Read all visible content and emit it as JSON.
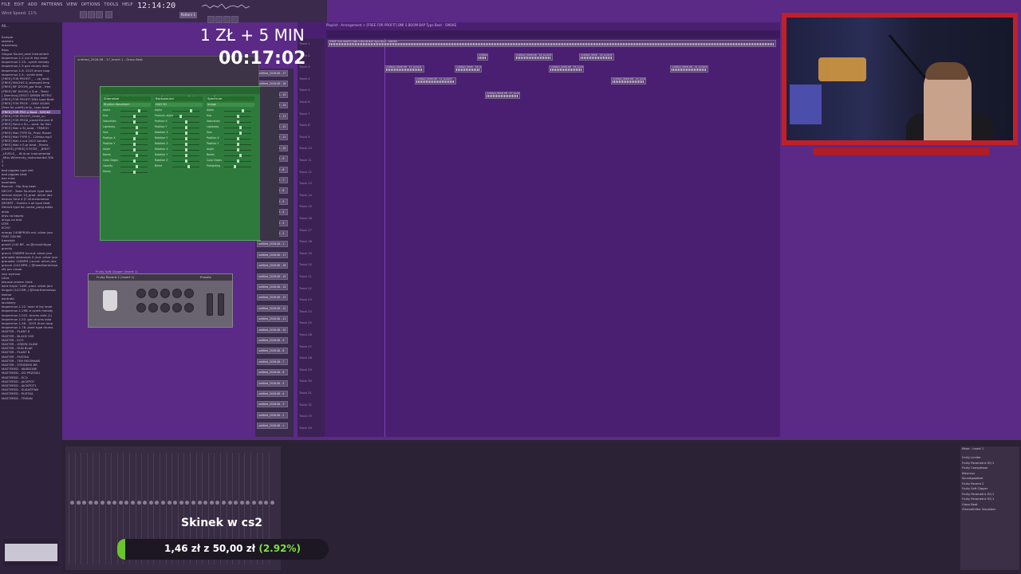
{
  "menu": {
    "items": [
      "FILE",
      "EDIT",
      "ADD",
      "PATTERNS",
      "VIEW",
      "OPTIONS",
      "TOOLS",
      "HELP"
    ],
    "hint": "Wind Speed: 11%",
    "time": "12:14:20",
    "pattern": "Pattern 1"
  },
  "browser": {
    "header": "All...",
    "items": [
      "Sample",
      "starters",
      "dreamway",
      "Bass",
      "Glogue Sound_ome Instrument",
      "leopermun.1.2 cut ik key level",
      "leopermun.1.25.. synth melody",
      "leopermun.1.5 gen drums dulo",
      "leopermun.1.6. 2015 drum loop",
      "leopermun.1.4.. synth lead",
      "[FREE] FOR PROFIT _ .. up_lead..",
      "[FREE] MACHIS & stomped-limp",
      "[FREE] MF DOOM_gor final - free",
      "[FREE] MF DOOM_x Sue - Tevor",
      "[ Dominus] DISCO DRYAN RETRO",
      "[FREE] FOR PROFIT DNA type Beat",
      "[FREE] FOR PROF... ONLY AGAIN",
      "[Free for profit] only_ type beat",
      "[FREE] FOR PRO x Beat - SMOKE",
      "[FREE] FOR PROFIT_fridel_uu",
      "[FREE] FOR PROA_proat.Kimove 6",
      "[FREE] Point x Su... prod. for fish",
      "[FREE] Mali x St_beat - TMMOO",
      "[FREE] Mali TYPE BI_ Prod. Rosen",
      "[FREE] Mali TYPE S.. 129hkz.mp3",
      "[FREE] Mali x cut 2022 tandev",
      "[FREE] Mali x S.pr beat _Tennis",
      "[VAXOS] [FREE] S ROSE_ _BHDT",
      "_LEVELS_ - IN ik.wr instrumental",
      "_Miss Wherecity_Instrumental 30k",
      "2",
      "3",
      "bad piggies type shit",
      "bad piggies beat",
      "bez miss",
      "boombap",
      "Bounce - Hip Hop beat",
      "DECOY - Town So.sliver type beat",
      "demon slayer 14_prod. oliver jarz",
      "demon time 4 (F..W.melomessa",
      "DESERT - Guestu x ok type beat",
      "Detroit type be..soma_pang adios",
      "drisk",
      "dros na bepria",
      "drugs na test",
      "DTM",
      "ECHO",
      "energy 140BPM.flk.md. oliver jarz",
      "FREE GIN ME",
      "freestyle",
      "gnosti (140 BP.. us.@unsolidtype",
      "gravity",
      "gracie 130BPM tur.md. oliver jarz",
      "grenadie diamonds 5 (md. oliver jarz",
      "grenadie 140BPM (.w.md. oliver jarz",
      "groove (144 BPM..) @hearthermessa",
      "idk per ciezar",
      "izzy wymour",
      "Libra",
      "Jesusse jestem hirek",
      "kent treya! 140E..prod. oliver jarz",
      "kingpin (143 BR..) @hearthermessa",
      "koshor",
      "kontrakt",
      "lavinbery",
      "leopermun.1.22. level ik ley level",
      "leopermun.1.298..e synth melody",
      "leopermun.1.522..drums dulo (1)",
      "leopermun.1.53..gen drums dulo",
      "leopermun.1.46.. 2053 drum loop",
      "leopermun.1.78..pixel type drums",
      "MASTER - PLANT 8",
      "MASTER - BLACK 200",
      "MASTER - ECO",
      "MASTER - GREEN GLIDE",
      "MASTER - RUN BLAK",
      "MASTER - PLANT B",
      "MASTER - PUSTKA",
      "MASTER - TEN REIZMANS",
      "MASTER - STRIDERS BR",
      "MASTERED - MARDONE",
      "MASTERED - DO PRZODU",
      "MASTERED - ECO",
      "MASTERED - JACKPOT",
      "MASTERED - JACKPOT2",
      "MASTERED - KUAASTWA",
      "MASTERED - PUSTKA",
      "MASTERED - TRISAN"
    ],
    "selected_index": 18
  },
  "playlist": {
    "title": "Playlist - Arrangement > [FREE FOR PROFIT] BMI S BOOM BAP Type Beat - SMOKE",
    "tracks": [
      "Track 1",
      "Track 2",
      "Track 3",
      "Track 4",
      "Track 5",
      "Track 6",
      "Track 7",
      "Track 8",
      "Track 9",
      "Track 10",
      "Track 11",
      "Track 12",
      "Track 13",
      "Track 14",
      "Track 15",
      "Track 16",
      "Track 17",
      "Track 18",
      "Track 19",
      "Track 20",
      "Track 21",
      "Track 22",
      "Track 23",
      "Track 24",
      "Track 25",
      "Track 26",
      "Track 27",
      "Track 28",
      "Track 29",
      "Track 30",
      "Track 31",
      "Track 32",
      "Track 33",
      "Track 34"
    ],
    "clips": [
      {
        "label": "[FREE FOR PROFIT] BMI S BOOM BAP Type Beat - SMOKE"
      },
      {
        "label": "untitled_2026-08 - 17_Audio3"
      },
      {
        "label": "untitled_2026-08 - 11_Audio3"
      },
      {
        "label": "untitled_2026 - 18_Audio3"
      },
      {
        "label": "untitled_2026-08 - 17_Audio3"
      },
      {
        "label": "untitled_2026-08 - 18_Audio3"
      },
      {
        "label": "untitled_2026-08 - 16_Audio3"
      },
      {
        "label": "untitled_2026-08 - 15_Audio3"
      },
      {
        "label": "untitled_2026 - 14_Audio3"
      },
      {
        "label": "untitled_2026-08 - 13_Audio3"
      },
      {
        "label": "untitled_2026-08 - 12_Audio3"
      }
    ]
  },
  "channel_rack": {
    "items": [
      "untitled_2026-08 - 17",
      "untitled_2026-08 - 16",
      "untitled_2026-08 - 15",
      "untitled_2026-08 - 14",
      "untitled_2026-08 - 13",
      "untitled_2026-08 - 12",
      "untitled_2026-08 - 11",
      "untitled_2026-08 - 10",
      "untitled_2026-08 - 9",
      "untitled_2026-08 - 8",
      "untitled_2026-08 - 7",
      "untitled_2026-08 - 6",
      "untitled_2026-08 - 5",
      "untitled_2026-08 - 4",
      "untitled_2026-08 - 3",
      "untitled_2026-08 - 2",
      "untitled_2026-08 - 1",
      "untitled_2026-08 - 17",
      "untitled_2026-08 - 16",
      "untitled_2026-08 - 15",
      "untitled_2026-08 - 14",
      "untitled_2026-08 - 13",
      "untitled_2026-08 - 12",
      "untitled_2026-08 - 11",
      "untitled_2026-08 - 10",
      "untitled_2026-08 - 9",
      "untitled_2026-08 - 8",
      "untitled_2026-08 - 7",
      "untitled_2026-08 - 6",
      "untitled_2026-08 - 5",
      "untitled_2026-08 - 4",
      "untitled_2026-08 - 3",
      "untitled_2026-08 - 2",
      "untitled_2026-08 - 1"
    ]
  },
  "plugins": {
    "gross_title": "untitled_2026-08 - 17_Insert 1 - Gross Beat",
    "green_tabs": [
      "Main",
      "Load content",
      "Settings",
      "Surface",
      "Debug log"
    ],
    "green_columns": [
      {
        "head": "Sidenoisel",
        "select": "Rhythm Waveform",
        "sliders": [
          "Alpha",
          "Hue",
          "Saturation",
          "Lightness",
          "Size",
          "Position X",
          "Position Y",
          "Angle",
          "Bands",
          "Color Edges",
          "Opacity",
          "Decay"
        ]
      },
      {
        "head": "Background",
        "select": "HUD 3D",
        "sliders": [
          "Alpha",
          "Premult. alpha",
          "Position X",
          "Position Y",
          "Rotation X",
          "Rotation Y",
          "Rotation Z",
          "Rotation X",
          "Rotation Y",
          "Rotation Z",
          "Blend"
        ]
      },
      {
        "head": "Spectrum",
        "select": "Image",
        "sliders": [
          "Alpha",
          "Hue",
          "Saturation",
          "Lightness",
          "Size",
          "Position X",
          "Position Y",
          "Angle",
          "Bands",
          "Color Edges",
          "Prelighting"
        ]
      }
    ],
    "green_levels": [
      [
        0.7,
        0.5,
        0.5,
        0.6,
        0.6,
        0.5,
        0.5,
        0.5,
        0.6,
        0.5,
        0.6,
        0.5
      ],
      [
        0.7,
        0.3,
        0.5,
        0.5,
        0.5,
        0.5,
        0.5,
        0.5,
        0.5,
        0.5,
        0.6
      ],
      [
        0.7,
        0.5,
        0.5,
        0.6,
        0.6,
        0.5,
        0.5,
        0.5,
        0.6,
        0.5,
        0.4
      ]
    ],
    "reverb_title": "Fruity Reverb 2 (Insert 1)",
    "softclip_title": "Fruity Soft Clipper (Insert 1)",
    "reverb_presets": "Presets"
  },
  "overlay": {
    "donation_rate": "1 ZŁ + 5 MIN",
    "timer": "00:17:02",
    "streamer": "Skinek w cs2",
    "goal_amount": "1,46 zł z 50,00 zł",
    "goal_percent": "(2.92%)",
    "goal_fraction": 0.0292
  },
  "mixer": {
    "fx_title": "Mixer - Insert 1",
    "fx_slots": [
      "Fruity Limiter",
      "Fruity Parametric EQ 2",
      "Fruity Compressor",
      "Maximus",
      "Soundgoodizer",
      "Fruity Reverb 2",
      "Fruity Soft Clipper",
      "Fruity Parametric EQ 2",
      "Fruity Parametric EQ 2",
      "Gross Beat",
      "ZGameEditor Visualizer"
    ],
    "channel_count": 34
  },
  "colors": {
    "accent_green": "#6ac52d",
    "cam_frame": "#c0202a",
    "playlist_bg": "#4a1f72"
  }
}
